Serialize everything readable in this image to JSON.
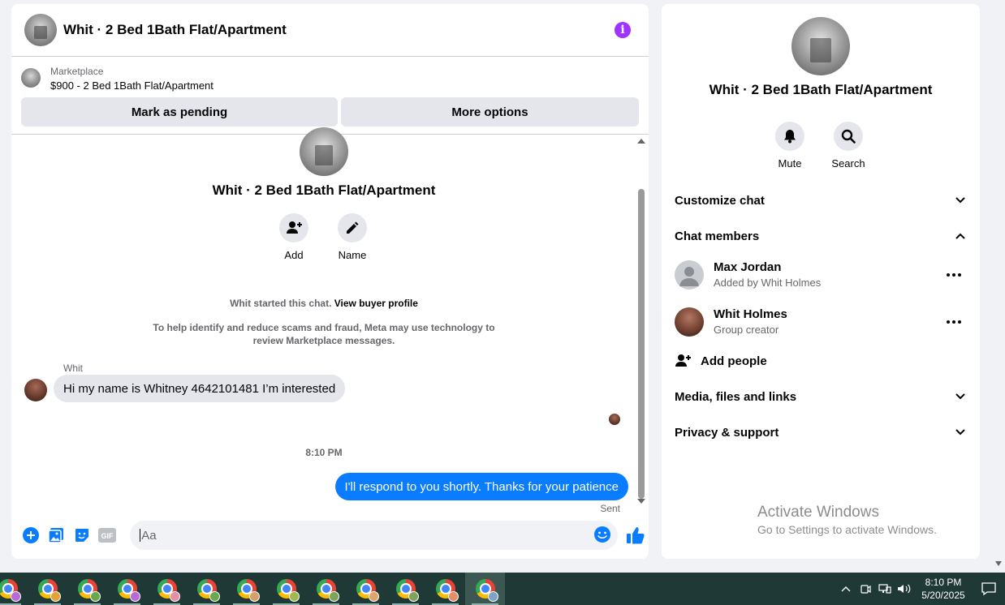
{
  "chat": {
    "header_title": "Whit · 2 Bed 1Bath Flat/Apartment",
    "info_icon_glyph": "i",
    "listing": {
      "category": "Marketplace",
      "description": "$900 - 2 Bed 1Bath Flat/Apartment",
      "mark_pending_label": "Mark as pending",
      "more_options_label": "More options"
    },
    "intro": {
      "title": "Whit · 2 Bed 1Bath Flat/Apartment",
      "add_label": "Add",
      "name_label": "Name",
      "started_text": "Whit started this chat.",
      "view_profile_link": "View buyer profile",
      "scam_notice": "To help identify and reduce scams and fraud, Meta may use technology to review Marketplace messages."
    },
    "messages": [
      {
        "sender": "Whit",
        "text": "Hi my name is Whitney 4642101481 I’m interested",
        "direction": "incoming"
      },
      {
        "text": "I'll respond to you shortly. Thanks for your patience",
        "direction": "outgoing",
        "status": "Sent"
      }
    ],
    "timestamp": "8:10 PM",
    "composer": {
      "placeholder": "Aa",
      "gif_label": "GIF",
      "icons": [
        "plus-circle-icon",
        "photo-icon",
        "sticker-icon",
        "gif-icon",
        "emoji-icon",
        "thumbs-up-icon"
      ]
    },
    "accent_color": "#0a7cff"
  },
  "details": {
    "title": "Whit · 2 Bed 1Bath Flat/Apartment",
    "mute_label": "Mute",
    "search_label": "Search",
    "sections": {
      "customize": "Customize chat",
      "members": "Chat members",
      "media": "Media, files and links",
      "privacy": "Privacy & support"
    },
    "members": [
      {
        "name": "Max Jordan",
        "subtitle": "Added by Whit Holmes"
      },
      {
        "name": "Whit Holmes",
        "subtitle": "Group creator"
      }
    ],
    "add_people_label": "Add people"
  },
  "watermark": {
    "line1": "Activate Windows",
    "line2": "Go to Settings to activate Windows."
  },
  "taskbar": {
    "time": "8:10 PM",
    "date": "5/20/2025",
    "app_icon": "chrome-icon",
    "badge_colors": [
      "#b96ad9",
      "#e2a23b",
      "#6aa84f",
      "#b96ad9",
      "#e58ea7",
      "#6aa84f",
      "#d3a06b",
      "#a0b84f",
      "#7fa35b",
      "#e0a46a",
      "#7fa35b",
      "#e58e6b",
      "#7fa3c8"
    ]
  }
}
